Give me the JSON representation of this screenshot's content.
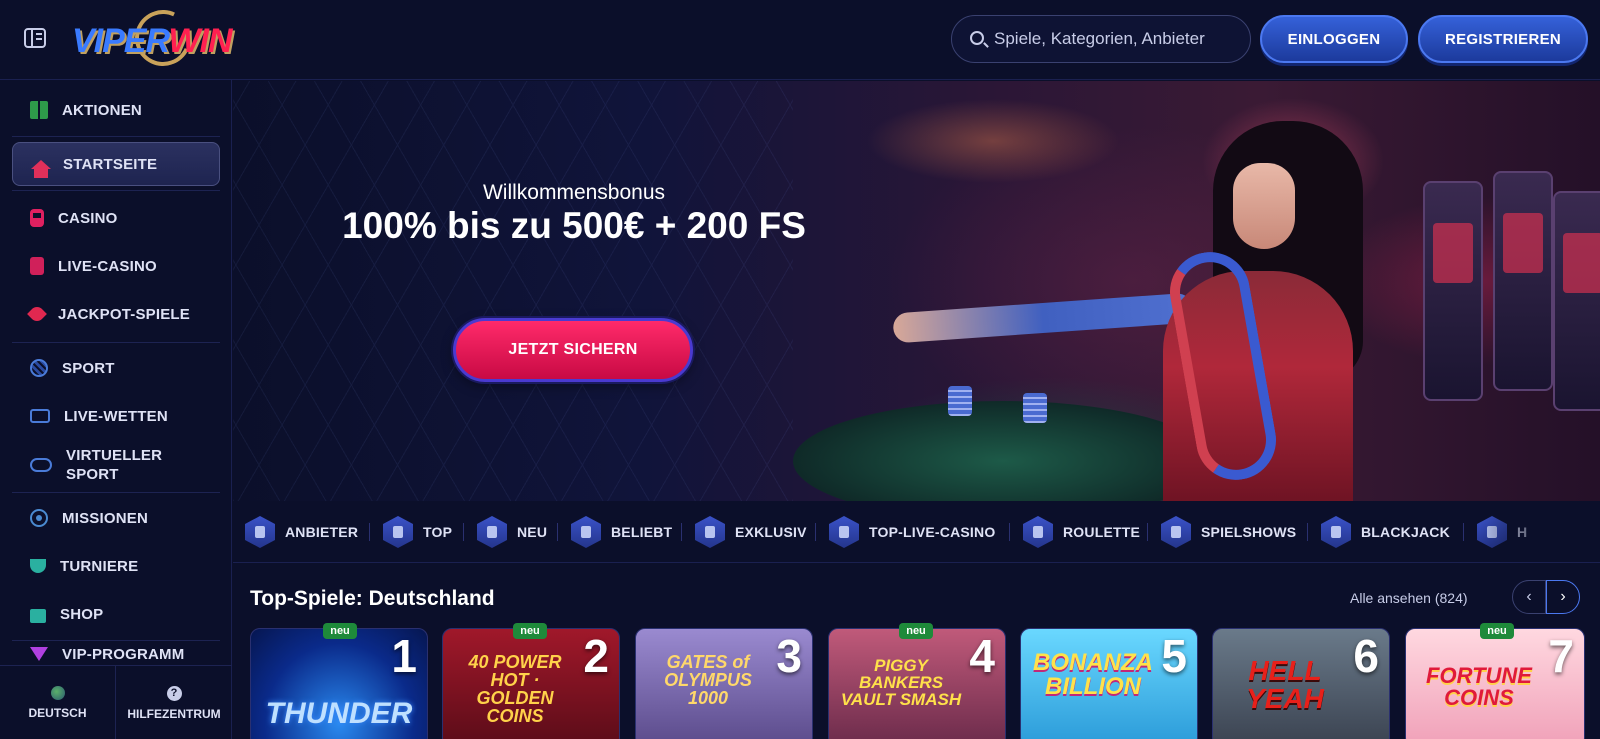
{
  "brand": {
    "name_a": "VIPER",
    "name_b": "WIN"
  },
  "header": {
    "search_placeholder": "Spiele, Kategorien, Anbieter",
    "login_label": "EINLOGGEN",
    "register_label": "REGISTRIEREN"
  },
  "sidebar": {
    "items": [
      {
        "label": "AKTIONEN",
        "icon": "gift-icon"
      },
      {
        "label": "STARTSEITE",
        "icon": "home-icon",
        "active": true
      },
      {
        "label": "CASINO",
        "icon": "slot-icon"
      },
      {
        "label": "LIVE-CASINO",
        "icon": "card-icon"
      },
      {
        "label": "JACKPOT-SPIELE",
        "icon": "clover-icon"
      },
      {
        "label": "SPORT",
        "icon": "ball-icon"
      },
      {
        "label": "LIVE-WETTEN",
        "icon": "live-tv-icon"
      },
      {
        "label": "VIRTUELLER SPORT",
        "icon": "gamepad-icon"
      },
      {
        "label": "MISSIONEN",
        "icon": "target-icon"
      },
      {
        "label": "TURNIERE",
        "icon": "trophy-icon"
      },
      {
        "label": "SHOP",
        "icon": "bag-icon"
      },
      {
        "label": "VIP-PROGRAMM",
        "icon": "diamond-icon"
      }
    ],
    "footer": {
      "language_label": "DEUTSCH",
      "help_label": "HILFEZENTRUM"
    }
  },
  "hero": {
    "kicker": "Willkommensbonus",
    "title": "100% bis zu 500€ + 200 FS",
    "cta_label": "JETZT SICHERN"
  },
  "categories": [
    {
      "label": "ANBIETER"
    },
    {
      "label": "TOP"
    },
    {
      "label": "NEU"
    },
    {
      "label": "BELIEBT"
    },
    {
      "label": "EXKLUSIV"
    },
    {
      "label": "TOP-LIVE-CASINO"
    },
    {
      "label": "ROULETTE"
    },
    {
      "label": "SPIELSHOWS"
    },
    {
      "label": "BLACKJACK"
    },
    {
      "label": "H"
    }
  ],
  "top_games": {
    "title": "Top-Spiele: Deutschland",
    "view_all_label": "Alle ansehen (824)",
    "new_badge": "neu",
    "games": [
      {
        "rank": "1",
        "art_text": "THUNDER",
        "badge": true
      },
      {
        "rank": "2",
        "art_text": "40 POWER HOT · GOLDEN COINS",
        "badge": true
      },
      {
        "rank": "3",
        "art_text": "GATES of OLYMPUS 1000",
        "badge": false
      },
      {
        "rank": "4",
        "art_text": "PIGGY BANKERS VAULT SMASH",
        "badge": true
      },
      {
        "rank": "5",
        "art_text": "BONANZA BILLION",
        "badge": false
      },
      {
        "rank": "6",
        "art_text": "HELL YEAH",
        "badge": false
      },
      {
        "rank": "7",
        "art_text": "FORTUNE COINS",
        "badge": true
      }
    ]
  },
  "colors": {
    "background": "#0b0f2a",
    "accent_blue": "#3561d9",
    "cta_pink": "#ff2a6a",
    "badge_green": "#1e8a3a"
  }
}
